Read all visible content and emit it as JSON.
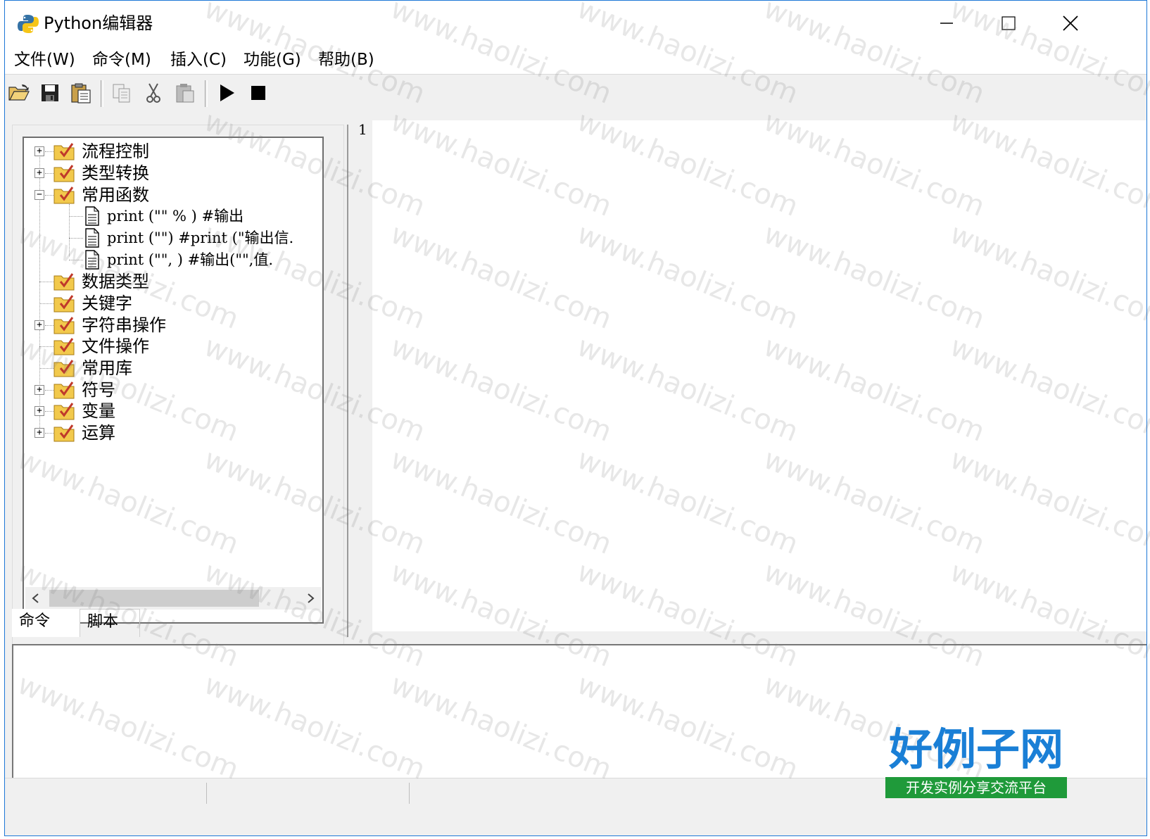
{
  "window": {
    "title": "Python编辑器"
  },
  "menu": [
    "文件(W)",
    "命令(M)",
    "插入(C)",
    "功能(G)",
    "帮助(B)"
  ],
  "toolbar": {
    "buttons": [
      "open-folder-icon",
      "save-icon",
      "paste-clipboard-icon",
      "copy-icon",
      "cut-icon",
      "paste-icon",
      "run-icon",
      "stop-icon"
    ]
  },
  "tree": {
    "items": [
      {
        "label": "流程控制",
        "expander": "+"
      },
      {
        "label": "类型转换",
        "expander": "+"
      },
      {
        "label": "常用函数",
        "expander": "−"
      },
      {
        "label": "print (\"\" % ) #输出"
      },
      {
        "label": "print (\"\") #print (\"输出信."
      },
      {
        "label": "print (\"\", ) #输出(\"\",值."
      },
      {
        "label": "数据类型"
      },
      {
        "label": "关键字"
      },
      {
        "label": "字符串操作",
        "expander": "+"
      },
      {
        "label": "文件操作"
      },
      {
        "label": "常用库"
      },
      {
        "label": "符号",
        "expander": "+"
      },
      {
        "label": "变量",
        "expander": "+"
      },
      {
        "label": "运算",
        "expander": "+"
      }
    ]
  },
  "tabs": [
    "命令",
    "脚本"
  ],
  "editor": {
    "line_numbers": [
      "1"
    ]
  },
  "watermark": "www.haolizi.com",
  "logo": {
    "title": "好例子网",
    "subtitle": "开发实例分享交流平台"
  },
  "colors": {
    "accent": "#1e78d7",
    "folder": "#f2c94c",
    "check": "#c0392b",
    "logo_blue": "#1a7fd6",
    "logo_green": "#1f9a3a"
  }
}
